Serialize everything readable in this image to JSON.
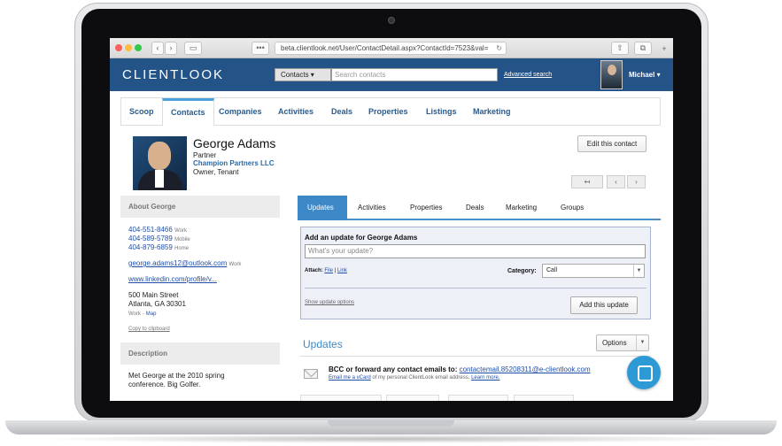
{
  "browser": {
    "url": "beta.clientlook.net/User/ContactDetail.aspx?ContactId=7523&val=",
    "dots_label": "•••",
    "back": "‹",
    "forward": "›",
    "reload": "↻",
    "share": "⇧",
    "tabs": "⧉",
    "newtab": "+"
  },
  "app": {
    "logo": "CLIENTLOOK",
    "search_type": "Contacts ▾",
    "search_placeholder": "Search contacts",
    "advanced_search": "Advanced search",
    "user_name": "Michael ▾"
  },
  "main_tabs": [
    "Scoop",
    "Contacts",
    "Companies",
    "Activities",
    "Deals",
    "Properties",
    "Listings",
    "Marketing"
  ],
  "contact": {
    "name": "George Adams",
    "title": "Partner",
    "company": "Champion Partners LLC",
    "role": "Owner, Tenant",
    "edit_label": "Edit this contact",
    "nav_back": "↤",
    "nav_prev": "‹",
    "nav_next": "›"
  },
  "about": {
    "heading": "About George",
    "phones": [
      {
        "number": "404-551-8466",
        "type": "Work"
      },
      {
        "number": "404-589-5789",
        "type": "Mobile"
      },
      {
        "number": "404-879-6859",
        "type": "Home"
      }
    ],
    "email": "george.adams12@outlook.com",
    "email_type": "Work",
    "linkedin": "www.linkedin.com/profile/v...",
    "address1": "500 Main Street",
    "address2": "Atlanta, GA 30301",
    "address_type": "Work",
    "map": "Map",
    "copy": "Copy to clipboard"
  },
  "description": {
    "heading": "Description",
    "text1": "Met George at the 2010 spring",
    "text2": "conference. Big Golfer."
  },
  "right_tabs": [
    "Updates",
    "Activities",
    "Properties",
    "Deals",
    "Marketing",
    "Groups"
  ],
  "update_form": {
    "label": "Add an update for George Adams",
    "placeholder": "What's your update?",
    "attach": "Attach:",
    "file": "File",
    "sep": "|",
    "link": "Link",
    "category_label": "Category:",
    "category_value": "Call",
    "show_options": "Show update options",
    "add_button": "Add this update"
  },
  "updates": {
    "heading": "Updates",
    "options": "Options",
    "bcc_text": "BCC or forward any contact emails to:",
    "bcc_email": "contactemail.85208311@e-clientlook.com",
    "sub_prefix": "Email me a vCard",
    "sub_text": "of my personal ClientLook email address.",
    "learn_more": "Learn more."
  }
}
